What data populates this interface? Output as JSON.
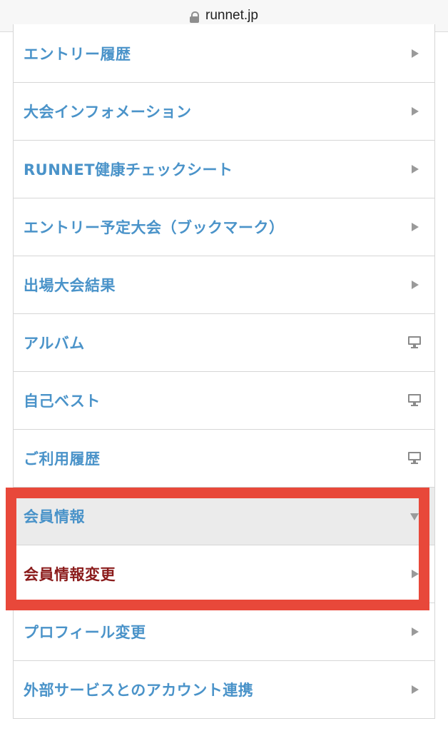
{
  "browser": {
    "url": "runnet.jp"
  },
  "menu": {
    "items": [
      {
        "label": "エントリー履歴",
        "icon": "chevron-right-icon"
      },
      {
        "label": "大会インフォメーション",
        "icon": "chevron-right-icon"
      },
      {
        "label": "RUNNET健康チェックシート",
        "icon": "chevron-right-icon"
      },
      {
        "label": "エントリー予定大会（ブックマーク）",
        "icon": "chevron-right-icon"
      },
      {
        "label": "出場大会結果",
        "icon": "chevron-right-icon"
      },
      {
        "label": "アルバム",
        "icon": "monitor-icon"
      },
      {
        "label": "自己ベスト",
        "icon": "monitor-icon"
      },
      {
        "label": "ご利用履歴",
        "icon": "monitor-icon"
      },
      {
        "label": "会員情報",
        "icon": "chevron-down-icon"
      },
      {
        "label": "会員情報変更",
        "icon": "chevron-right-icon"
      },
      {
        "label": "プロフィール変更",
        "icon": "chevron-right-icon"
      },
      {
        "label": "外部サービスとのアカウント連携",
        "icon": "chevron-right-icon"
      }
    ]
  },
  "colors": {
    "link": "#4a93c9",
    "active_link": "#8b1c1c",
    "highlight_border": "#e8483a",
    "section_header_bg": "#ebebeb"
  }
}
